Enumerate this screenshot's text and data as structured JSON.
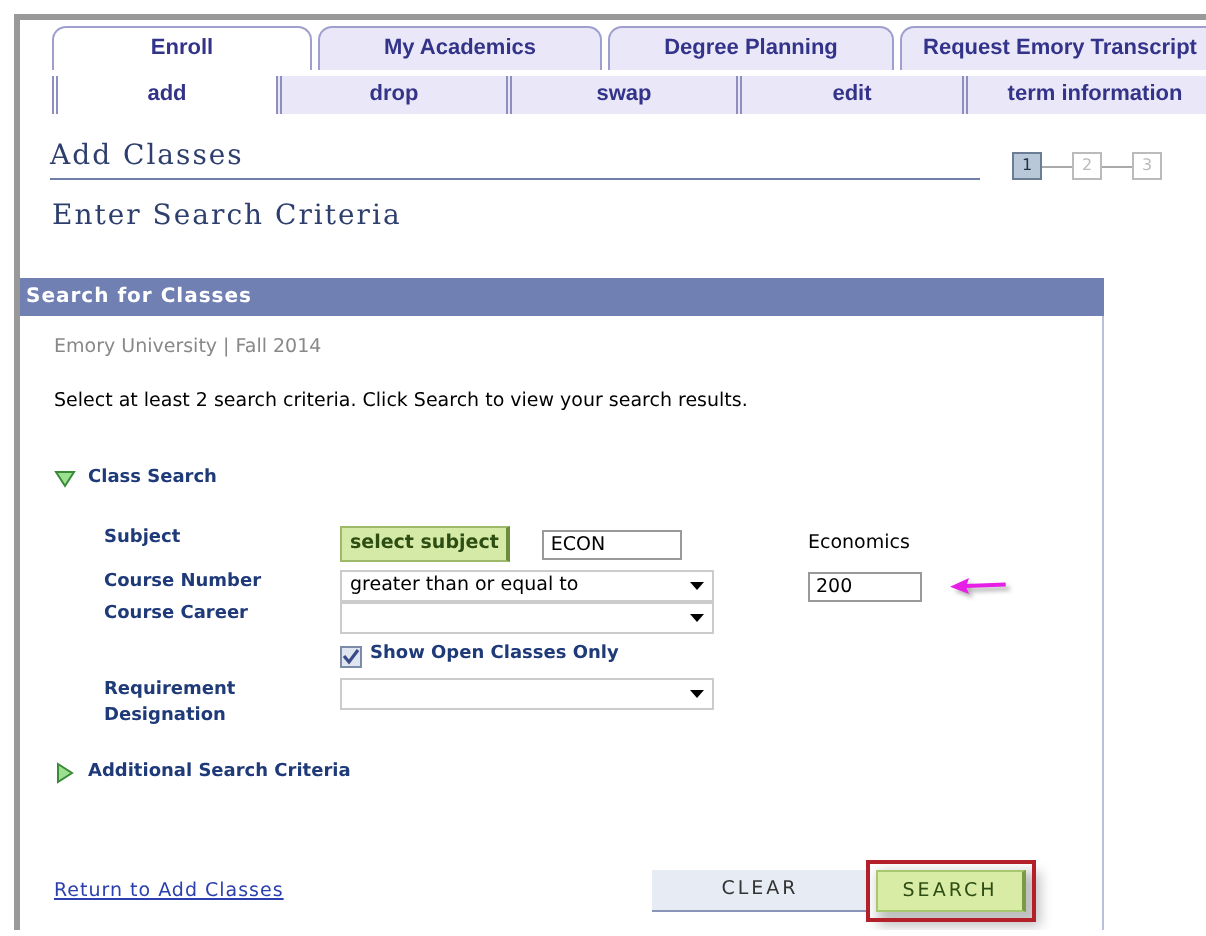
{
  "tabs": [
    {
      "label": "Enroll",
      "selected": true
    },
    {
      "label": "My Academics",
      "selected": false
    },
    {
      "label": "Degree Planning",
      "selected": false
    },
    {
      "label": "Request Emory Transcript",
      "selected": false
    }
  ],
  "subtabs": [
    {
      "label": "add",
      "selected": true
    },
    {
      "label": "drop",
      "selected": false
    },
    {
      "label": "swap",
      "selected": false
    },
    {
      "label": "edit",
      "selected": false
    },
    {
      "label": "term information",
      "selected": false
    }
  ],
  "page_title": "Add Classes",
  "steps": [
    {
      "label": "1",
      "selected": true
    },
    {
      "label": "2",
      "selected": false
    },
    {
      "label": "3",
      "selected": false
    }
  ],
  "section_title": "Enter Search Criteria",
  "panel": {
    "title": "Search for Classes",
    "institution_term": "Emory University | Fall 2014",
    "instructions": "Select at least 2 search criteria. Click Search to view your search results.",
    "class_search": {
      "label": "Class Search",
      "expanded": true
    },
    "fields": [
      {
        "kind": "subject",
        "label": "Subject",
        "button": "select subject",
        "value": "ECON",
        "description": "Economics"
      },
      {
        "kind": "select-input",
        "label": "Course Number",
        "value": "greater than or equal to",
        "input_value": "200",
        "annotated": true
      },
      {
        "kind": "select",
        "label": "Course Career"
      },
      {
        "kind": "checkbox",
        "label": "Show Open Classes Only",
        "checked": true
      },
      {
        "kind": "select",
        "label": "Requirement Designation"
      }
    ],
    "additional": {
      "label": "Additional Search Criteria",
      "expanded": false
    },
    "link": "Return to Add Classes",
    "buttons": [
      {
        "label": "CLEAR",
        "highlighted": false
      },
      {
        "label": "SEARCH",
        "highlighted": true
      }
    ]
  }
}
